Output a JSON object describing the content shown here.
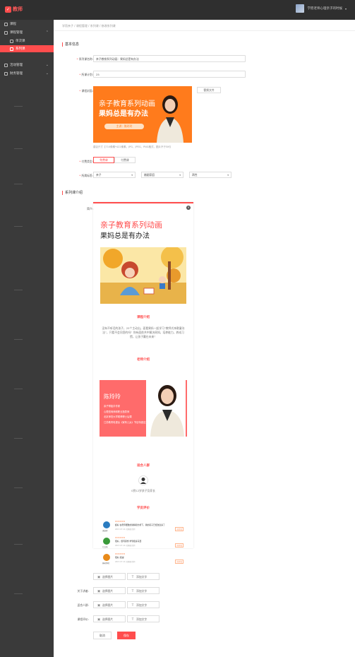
{
  "app": {
    "name": "教师",
    "logo_glyph": "✓"
  },
  "user": {
    "name": "学而老师心理亲子的时候",
    "arrow": "▾"
  },
  "sidebar": {
    "items": [
      {
        "label": "课程",
        "icon": "home-icon",
        "chev": ""
      },
      {
        "label": "课程管理",
        "icon": "grid-icon",
        "chev": "⌃"
      },
      {
        "label": "单次课",
        "icon": "doc-icon",
        "chev": ""
      },
      {
        "label": "系列课",
        "icon": "doc-icon",
        "chev": ""
      },
      {
        "label": "活动管理",
        "icon": "flag-icon",
        "chev": "⌄"
      },
      {
        "label": "财务管理",
        "icon": "money-icon",
        "chev": "⌄"
      }
    ]
  },
  "breadcrumb": "学而亲子 / 课程管理 / 系列课 / 修改系列课",
  "basic": {
    "title": "基本信息",
    "name_label": "系列课名称:",
    "name_value": "亲子教育系列动画：果妈总是有办法",
    "count_label": "所课计划:",
    "count_value": "25",
    "cover_label": "课程封面:",
    "cover": {
      "t1": "亲子教育系列动画",
      "t2": "果妈总是有办法",
      "pill": "主讲：陈玲玲"
    },
    "replace_btn": "替换文件",
    "hint": "建议尺寸【710像素*422像素，JPG、JPEG、PNG格式，图片不于5M】",
    "fee_label": "付费类型:",
    "fee_free": "免费课",
    "fee_paid": "付费课",
    "cat_label": "所属标签:",
    "selects": [
      "亲子",
      "婚姻家庭",
      "两性"
    ],
    "dd": "▾"
  },
  "intro": {
    "title": "系列课介绍",
    "intro_label": "简介:",
    "close": "×",
    "h1": "亲子教育系列动画",
    "h2": "果妈总是有办法",
    "course_title": "课程介绍",
    "course_text": "没有不听话的孩子，25个主动出。面看果妈一起学习“教师式亲歌童沟法”，只看不会问您的吗！你有面前共中解决周知，培养能力，养成习惯，让孩子赢在未来！",
    "teacher_title": "老师介绍",
    "teacher_name": "陈玲玲",
    "teacher_items": [
      "亲子帮姐手作家",
      "心理咨询师和职业指导师",
      "北京师范大学硕博博士后课",
      "江苏教育电视台《家有儿女》节目特邀嘉宾"
    ],
    "audience_title": "适合人群",
    "audience_text": "0到12岁孩子及家长",
    "review_title": "学员评价",
    "reviews": [
      {
        "name": "流浪者",
        "stars": "★★★★★",
        "text": "超好 在老师细致的讲解和分析下，我的孩子已经改变多了",
        "meta": "2017-07-11  已购课  回复",
        "tag": "好评论",
        "color": "#2b7cc0"
      },
      {
        "name": "七点前",
        "stars": "★★★★★",
        "text": "很好，很有思想 学到很多东西",
        "meta": "2017-07-11  已购课  回复",
        "tag": "好评论",
        "color": "#3a9a3a"
      },
      {
        "name": "康老师哈",
        "stars": "★★★★★",
        "text": "很好 加油！",
        "meta": "2017-07-11  已购课  回复",
        "tag": "好评论",
        "color": "#e88a1a"
      }
    ]
  },
  "actions": {
    "add_img": "选择图片",
    "add_txt": "添加文字",
    "img_glyph": "▣",
    "txt_glyph": "T",
    "rows": [
      "",
      "关于讲者:",
      "适合人群:",
      "课程评价:"
    ],
    "cancel": "取消",
    "save": "保存"
  }
}
